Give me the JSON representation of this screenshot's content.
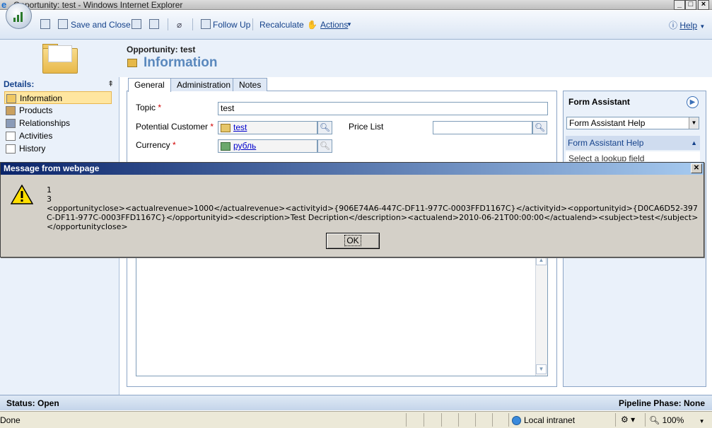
{
  "window": {
    "title": "Opportunity: test - Windows Internet Explorer"
  },
  "toolbar": {
    "save_close": "Save and Close",
    "follow_up": "Follow Up",
    "recalculate": "Recalculate",
    "actions": "Actions",
    "help": "Help"
  },
  "header": {
    "entity_label": "Opportunity: test",
    "form_title": "Information"
  },
  "nav": {
    "header": "Details:",
    "items": [
      {
        "label": "Information"
      },
      {
        "label": "Products"
      },
      {
        "label": "Relationships"
      },
      {
        "label": "Activities"
      },
      {
        "label": "History"
      }
    ]
  },
  "tabs": [
    {
      "label": "General"
    },
    {
      "label": "Administration"
    },
    {
      "label": "Notes"
    }
  ],
  "form": {
    "topic_label": "Topic",
    "topic_value": "test",
    "customer_label": "Potential Customer",
    "customer_value": "test",
    "pricelist_label": "Price List",
    "currency_label": "Currency",
    "currency_value": "рубль",
    "required_mark": "*"
  },
  "assistant": {
    "title": "Form Assistant",
    "selected": "Form Assistant Help",
    "section": "Form Assistant Help",
    "body_text": "Select a lookup field"
  },
  "dialog": {
    "title": "Message from webpage",
    "line1": "1",
    "line2": "3",
    "line3": "<opportunityclose><actualrevenue>1000</actualrevenue><activityid>{906E74A6-447C-DF11-977C-0003FFD1167C}</activityid><opportunityid>{D0CA6D52-397C-DF11-977C-0003FFD1167C}</opportunityid><description>Test Decription</description><actualend>2010-06-21T00:00:00</actualend><subject>test</subject></opportunityclose>",
    "ok_label": "OK"
  },
  "status": {
    "left": "Status: Open",
    "right": "Pipeline Phase: None"
  },
  "ie_status": {
    "done": "Done",
    "zone": "Local intranet",
    "zoom": "100%"
  },
  "colors": {
    "accent": "#15428b",
    "dialog_title": "#0a246a"
  }
}
